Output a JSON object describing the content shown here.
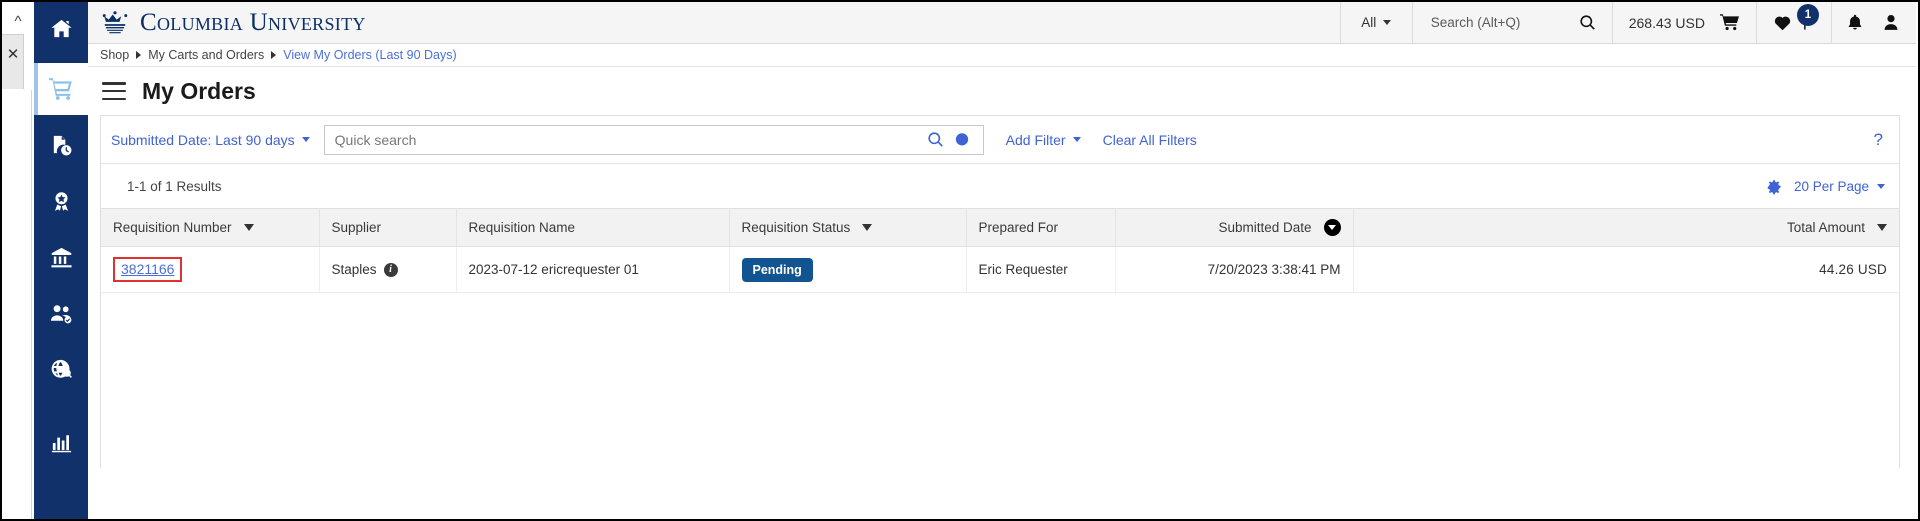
{
  "brand": {
    "name": "Columbia University",
    "crown_icon": "crown-icon"
  },
  "browser_chrome": {
    "collapse_icon": "chevron-up-icon",
    "close_icon": "close-icon"
  },
  "sidebar": {
    "items": [
      {
        "icon": "home-icon",
        "name": "sidebar-item-home",
        "active": false
      },
      {
        "icon": "shopping-cart-icon",
        "name": "sidebar-item-shop",
        "active": true
      },
      {
        "icon": "document-clock-icon",
        "name": "sidebar-item-orders",
        "active": false
      },
      {
        "icon": "award-ribbon-icon",
        "name": "sidebar-item-contracts",
        "active": false
      },
      {
        "icon": "bank-icon",
        "name": "sidebar-item-accounts-payable",
        "active": false
      },
      {
        "icon": "users-check-icon",
        "name": "sidebar-item-suppliers",
        "active": false
      },
      {
        "icon": "globe-search-icon",
        "name": "sidebar-item-sourcing",
        "active": false
      },
      {
        "icon": "bar-chart-icon",
        "name": "sidebar-item-reporting",
        "active": false
      }
    ]
  },
  "topbar": {
    "scope_label": "All",
    "search_placeholder": "Search (Alt+Q)",
    "search_icon": "search-icon",
    "cart_amount": "268.43 USD",
    "cart_icon": "shopping-cart-icon",
    "favorites_icon": "heart-icon",
    "flag_icon": "flag-icon",
    "flag_badge": "1",
    "notifications_icon": "bell-icon",
    "profile_icon": "user-icon"
  },
  "breadcrumb": {
    "items": [
      {
        "label": "Shop",
        "link": false
      },
      {
        "label": "My Carts and Orders",
        "link": false
      },
      {
        "label": "View My Orders (Last 90 Days)",
        "link": true
      }
    ]
  },
  "page": {
    "menu_icon": "hamburger-menu-icon",
    "title": "My Orders"
  },
  "filters": {
    "date_filter_label": "Submitted Date: Last 90 days",
    "quick_search_placeholder": "Quick search",
    "quick_search_value": "",
    "search_icon": "search-icon",
    "saved_search_icon": "history-search-icon",
    "add_filter_label": "Add Filter",
    "clear_filters_label": "Clear All Filters",
    "help_label": "?"
  },
  "results": {
    "count_label": "1-1 of 1 Results",
    "settings_icon": "gear-icon",
    "per_page_label": "20 Per Page"
  },
  "table": {
    "columns": [
      {
        "label": "Requisition Number",
        "sort": "triangle",
        "align": "left"
      },
      {
        "label": "Supplier",
        "sort": "none",
        "align": "left"
      },
      {
        "label": "Requisition Name",
        "sort": "none",
        "align": "left"
      },
      {
        "label": "Requisition Status",
        "sort": "triangle",
        "align": "left"
      },
      {
        "label": "Prepared For",
        "sort": "none",
        "align": "left"
      },
      {
        "label": "Submitted Date",
        "sort": "circle-down",
        "align": "right"
      },
      {
        "label": "Total Amount",
        "sort": "triangle",
        "align": "right"
      }
    ],
    "rows": [
      {
        "requisition_number": "3821166",
        "supplier": "Staples",
        "supplier_info_icon": "info-icon",
        "requisition_name": "2023-07-12 ericrequester 01",
        "status": "Pending",
        "prepared_for": "Eric Requester",
        "submitted_date": "7/20/2023 3:38:41 PM",
        "total_amount": "44.26  USD"
      }
    ]
  },
  "colors": {
    "brand_navy": "#11316b",
    "link_blue": "#4a6fd8",
    "action_blue": "#3f63d4",
    "status_pending": "#11548f",
    "highlight_red": "#e03131"
  }
}
